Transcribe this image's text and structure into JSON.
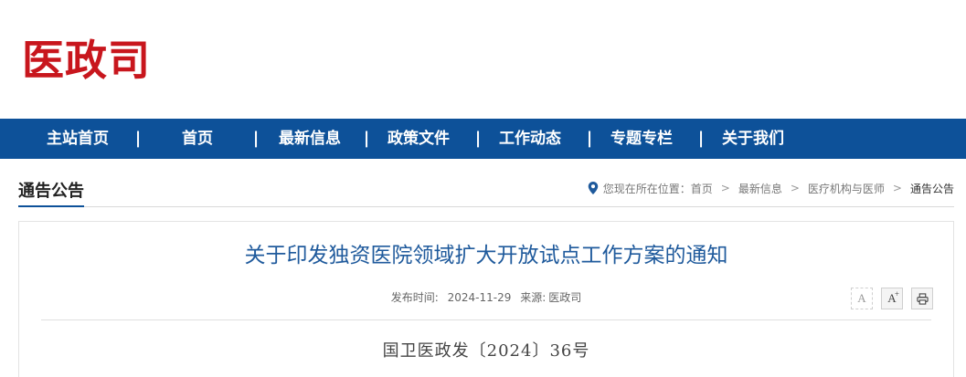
{
  "site": {
    "logo_text": "医政司"
  },
  "nav": {
    "items": [
      {
        "label": "主站首页"
      },
      {
        "label": "首页"
      },
      {
        "label": "最新信息"
      },
      {
        "label": "政策文件"
      },
      {
        "label": "工作动态"
      },
      {
        "label": "专题专栏"
      },
      {
        "label": "关于我们"
      }
    ],
    "separator": "|"
  },
  "section": {
    "title": "通告公告"
  },
  "breadcrumb": {
    "prefix": "您现在所在位置：",
    "items": [
      {
        "label": "首页"
      },
      {
        "label": "最新信息"
      },
      {
        "label": "医疗机构与医师"
      },
      {
        "label": "通告公告"
      }
    ]
  },
  "article": {
    "title": "关于印发独资医院领域扩大开放试点工作方案的通知",
    "publish_label": "发布时间:",
    "publish_date": "2024-11-29",
    "source_label": "来源:",
    "source": "医政司",
    "doc_number": "国卫医政发〔2024〕36号"
  },
  "tools": {
    "font_smaller": "A",
    "font_larger": "A",
    "font_larger_sup": "+",
    "print_icon": "printer-icon"
  },
  "colors": {
    "brand_red": "#c8161d",
    "nav_blue": "#0d5199",
    "title_blue": "#1f5a9c"
  }
}
